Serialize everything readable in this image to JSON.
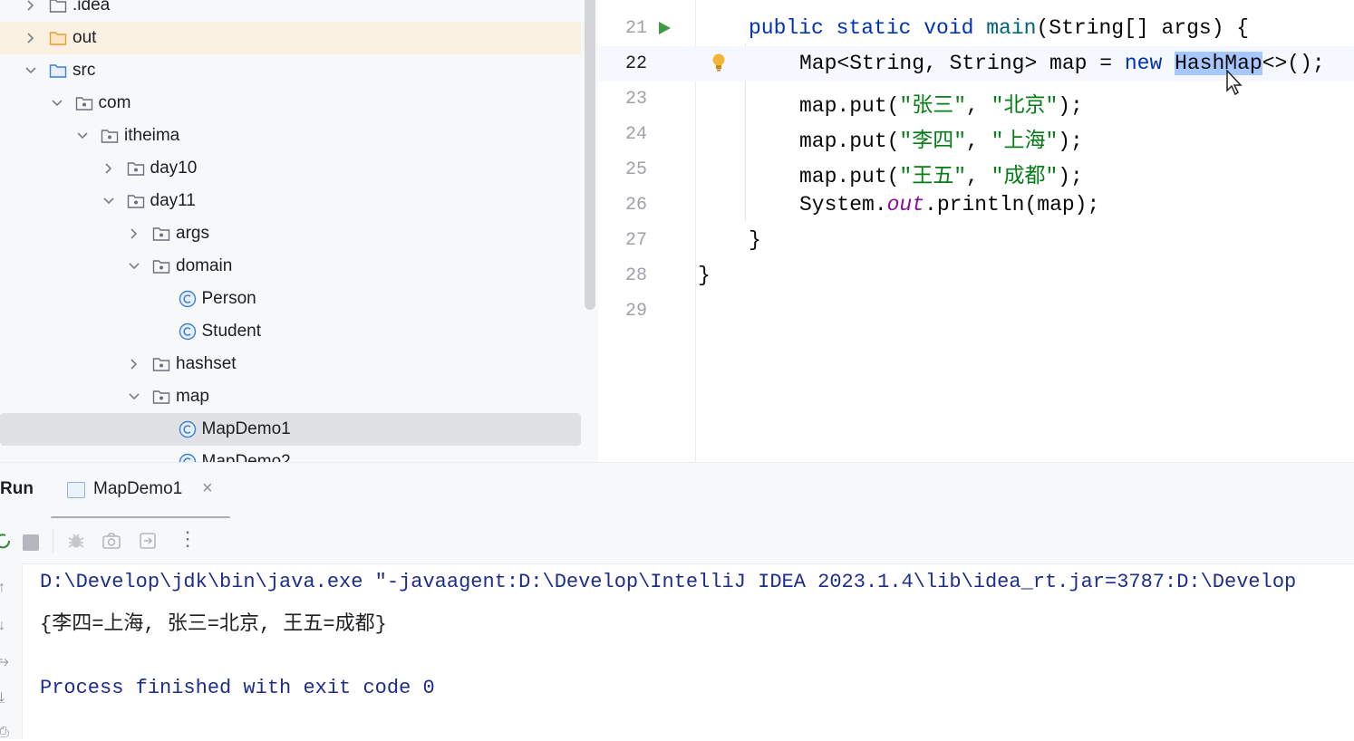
{
  "project_tree": {
    "items": [
      {
        "label": ".idea",
        "type": "folder",
        "state": "collapsed"
      },
      {
        "label": "out",
        "type": "folder-excluded",
        "state": "collapsed"
      },
      {
        "label": "src",
        "type": "source-folder",
        "state": "expanded"
      },
      {
        "label": "com",
        "type": "package",
        "state": "expanded"
      },
      {
        "label": "itheima",
        "type": "package",
        "state": "expanded"
      },
      {
        "label": "day10",
        "type": "package",
        "state": "collapsed"
      },
      {
        "label": "day11",
        "type": "package",
        "state": "expanded"
      },
      {
        "label": "args",
        "type": "package",
        "state": "collapsed"
      },
      {
        "label": "domain",
        "type": "package",
        "state": "expanded"
      },
      {
        "label": "Person",
        "type": "class"
      },
      {
        "label": "Student",
        "type": "class"
      },
      {
        "label": "hashset",
        "type": "package",
        "state": "collapsed"
      },
      {
        "label": "map",
        "type": "package",
        "state": "expanded"
      },
      {
        "label": "MapDemo1",
        "type": "class",
        "selected": true
      },
      {
        "label": "MapDemo2",
        "type": "class"
      }
    ]
  },
  "editor": {
    "lines": [
      {
        "number": "21",
        "run_marker": true,
        "segments": [
          {
            "t": "public static void ",
            "c": "kw"
          },
          {
            "t": "main",
            "c": "fn"
          },
          {
            "t": "(String[] args) {",
            "c": ""
          }
        ]
      },
      {
        "number": "22",
        "current": true,
        "bulb": true,
        "segments": [
          {
            "t": "Map<String, String> map = ",
            "c": ""
          },
          {
            "t": "new ",
            "c": "kw"
          },
          {
            "t": "HashMap",
            "c": "sel"
          },
          {
            "t": "<>();",
            "c": ""
          }
        ]
      },
      {
        "number": "23",
        "segments": [
          {
            "t": "map.put(",
            "c": ""
          },
          {
            "t": "\"张三\"",
            "c": "str"
          },
          {
            "t": ", ",
            "c": ""
          },
          {
            "t": "\"北京\"",
            "c": "str"
          },
          {
            "t": ");",
            "c": ""
          }
        ]
      },
      {
        "number": "24",
        "segments": [
          {
            "t": "map.put(",
            "c": ""
          },
          {
            "t": "\"李四\"",
            "c": "str"
          },
          {
            "t": ", ",
            "c": ""
          },
          {
            "t": "\"上海\"",
            "c": "str"
          },
          {
            "t": ");",
            "c": ""
          }
        ]
      },
      {
        "number": "25",
        "segments": [
          {
            "t": "map.put(",
            "c": ""
          },
          {
            "t": "\"王五\"",
            "c": "str"
          },
          {
            "t": ", ",
            "c": ""
          },
          {
            "t": "\"成都\"",
            "c": "str"
          },
          {
            "t": ");",
            "c": ""
          }
        ]
      },
      {
        "number": "26",
        "segments": [
          {
            "t": "System.",
            "c": ""
          },
          {
            "t": "out",
            "c": "static-field"
          },
          {
            "t": ".println(map);",
            "c": ""
          }
        ]
      },
      {
        "number": "27",
        "segments": [
          {
            "t": "}",
            "c": ""
          }
        ]
      },
      {
        "number": "28",
        "segments": [
          {
            "t": "}",
            "c": ""
          }
        ]
      },
      {
        "number": "29",
        "segments": []
      }
    ]
  },
  "run_panel": {
    "title": "Run",
    "tab_label": "MapDemo1",
    "console": {
      "command": "D:\\Develop\\jdk\\bin\\java.exe \"-javaagent:D:\\Develop\\IntelliJ IDEA 2023.1.4\\lib\\idea_rt.jar=3787:D:\\Develop",
      "output": "{李四=上海, 张三=北京, 王五=成都}",
      "finish": "Process finished with exit code 0"
    }
  },
  "colors": {
    "keyword": "#0033b3",
    "string": "#067d17",
    "selection": "#a6c8ff",
    "console_blue": "#1d2d8e"
  }
}
